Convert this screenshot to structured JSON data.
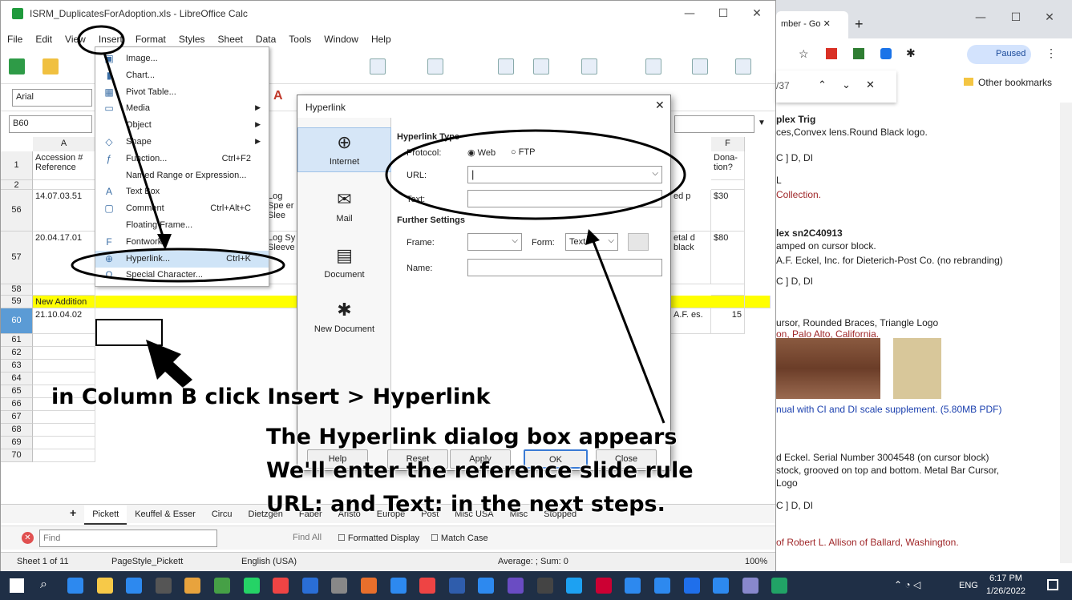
{
  "calc": {
    "title": "ISRM_DuplicatesForAdoption.xls - LibreOffice Calc",
    "menu": [
      "File",
      "Edit",
      "View",
      "Insert",
      "Format",
      "Styles",
      "Sheet",
      "Data",
      "Tools",
      "Window",
      "Help"
    ],
    "font_name": "Arial",
    "name_box": "B60",
    "col_a": "A",
    "col_f": "F",
    "rows": [
      {
        "num": "1",
        "a": "Accession # Reference",
        "f": "Dona-tion?"
      },
      {
        "num": "2",
        "a": "",
        "f": ""
      },
      {
        "num": "56",
        "a": "14.07.03.51",
        "c": "Log Spe er Slee",
        "e": "ed p",
        "f": "$30"
      },
      {
        "num": "57",
        "a": "20.04.17.01",
        "c": "Log Sy Sleeve",
        "e": "etal d black",
        "f": "$80"
      },
      {
        "num": "58",
        "a": "",
        "f": ""
      },
      {
        "num": "59",
        "a": "New Addition",
        "f": ""
      },
      {
        "num": "60",
        "a": "21.10.04.02",
        "e": "A.F. es.",
        "f": "15"
      },
      {
        "num": "61"
      },
      {
        "num": "62"
      },
      {
        "num": "63"
      },
      {
        "num": "64"
      },
      {
        "num": "65"
      },
      {
        "num": "66"
      },
      {
        "num": "67"
      },
      {
        "num": "68"
      },
      {
        "num": "69"
      },
      {
        "num": "70"
      }
    ],
    "tabs": [
      "Pickett",
      "Keuffel & Esser",
      "Circu",
      "Dietzgen",
      "Faber",
      "Aristo",
      "Europe",
      "Post",
      "Misc USA",
      "Misc",
      "Stopped"
    ],
    "find": {
      "placeholder": "Find",
      "find_all": "Find All",
      "formatted": "Formatted Display",
      "match_case": "Match Case"
    },
    "status": {
      "sheet": "Sheet 1 of 11",
      "style": "PageStyle_Pickett",
      "lang": "English (USA)",
      "avg": "Average: ; Sum: 0",
      "zoom": "100%"
    }
  },
  "insert_menu": [
    {
      "label": "Image...",
      "icon": "image-icon"
    },
    {
      "label": "Chart...",
      "icon": "chart-icon"
    },
    {
      "label": "Pivot Table...",
      "icon": "pivot-icon"
    },
    {
      "label": "Media",
      "icon": "media-icon",
      "sub": true
    },
    {
      "label": "Object",
      "icon": "",
      "sub": true
    },
    {
      "label": "Shape",
      "icon": "shape-icon",
      "sub": true
    },
    {
      "label": "Function...",
      "icon": "function-icon",
      "shortcut": "Ctrl+F2"
    },
    {
      "label": "Named Range or Expression...",
      "icon": ""
    },
    {
      "label": "Text Box",
      "icon": "textbox-icon"
    },
    {
      "label": "Comment",
      "icon": "comment-icon",
      "shortcut": "Ctrl+Alt+C"
    },
    {
      "label": "Floating Frame...",
      "icon": ""
    },
    {
      "label": "Fontwork",
      "icon": "fontwork-icon"
    },
    {
      "label": "Hyperlink...",
      "icon": "hyperlink-icon",
      "shortcut": "Ctrl+K"
    },
    {
      "label": "Special Character...",
      "icon": "special-char-icon"
    }
  ],
  "dialog": {
    "title": "Hyperlink",
    "side": [
      "Internet",
      "Mail",
      "Document",
      "New Document"
    ],
    "type_heading": "Hyperlink Type",
    "protocol": "Protocol:",
    "web": "Web",
    "ftp": "FTP",
    "url": "URL:",
    "text": "Text:",
    "further": "Further Settings",
    "frame": "Frame:",
    "form": "Form:",
    "form_value": "Text",
    "name": "Name:",
    "buttons": [
      "Help",
      "Reset",
      "Apply",
      "OK",
      "Close"
    ]
  },
  "chrome": {
    "tab_title": "mber - Go",
    "find_count": "/37",
    "paused": "Paused",
    "other_bookmarks": "Other bookmarks",
    "lines": [
      {
        "t": "plex Trig",
        "cls": "bold"
      },
      {
        "t": "ces,Convex lens.Round Black logo."
      },
      {
        "t": "C ] D, DI"
      },
      {
        "t": "L"
      },
      {
        "t": "Collection.",
        "cls": "red"
      },
      {
        "t": "lex sn2C40913",
        "cls": "bold"
      },
      {
        "t": "amped on cursor block."
      },
      {
        "t": "A.F. Eckel, Inc. for Dieterich-Post Co. (no rebranding)"
      },
      {
        "t": "C ] D, DI"
      },
      {
        "t": "ursor, Rounded Braces, Triangle Logo"
      },
      {
        "t": "on, Palo Alto, California.",
        "cls": "red"
      },
      {
        "t": "nual with CI and DI scale supplement. (5.80MB PDF)",
        "cls": "blue"
      },
      {
        "t": "d Eckel. Serial Number 3004548 (on cursor block)"
      },
      {
        "t": "stock, grooved on top and bottom. Metal Bar Cursor,"
      },
      {
        "t": "Logo"
      },
      {
        "t": "C ] D, DI"
      },
      {
        "t": "of Robert L. Allison of Ballard, Washington.",
        "cls": "red"
      }
    ]
  },
  "annotations": {
    "a1": "in Column B click Insert > Hyperlink",
    "a2": "The Hyperlink dialog box appears",
    "a3": "We'll enter the reference slide rule",
    "a4": "URL: and Text: in the next steps."
  },
  "taskbar": {
    "lang": "ENG",
    "time": "6:17 PM",
    "date": "1/26/2022"
  }
}
